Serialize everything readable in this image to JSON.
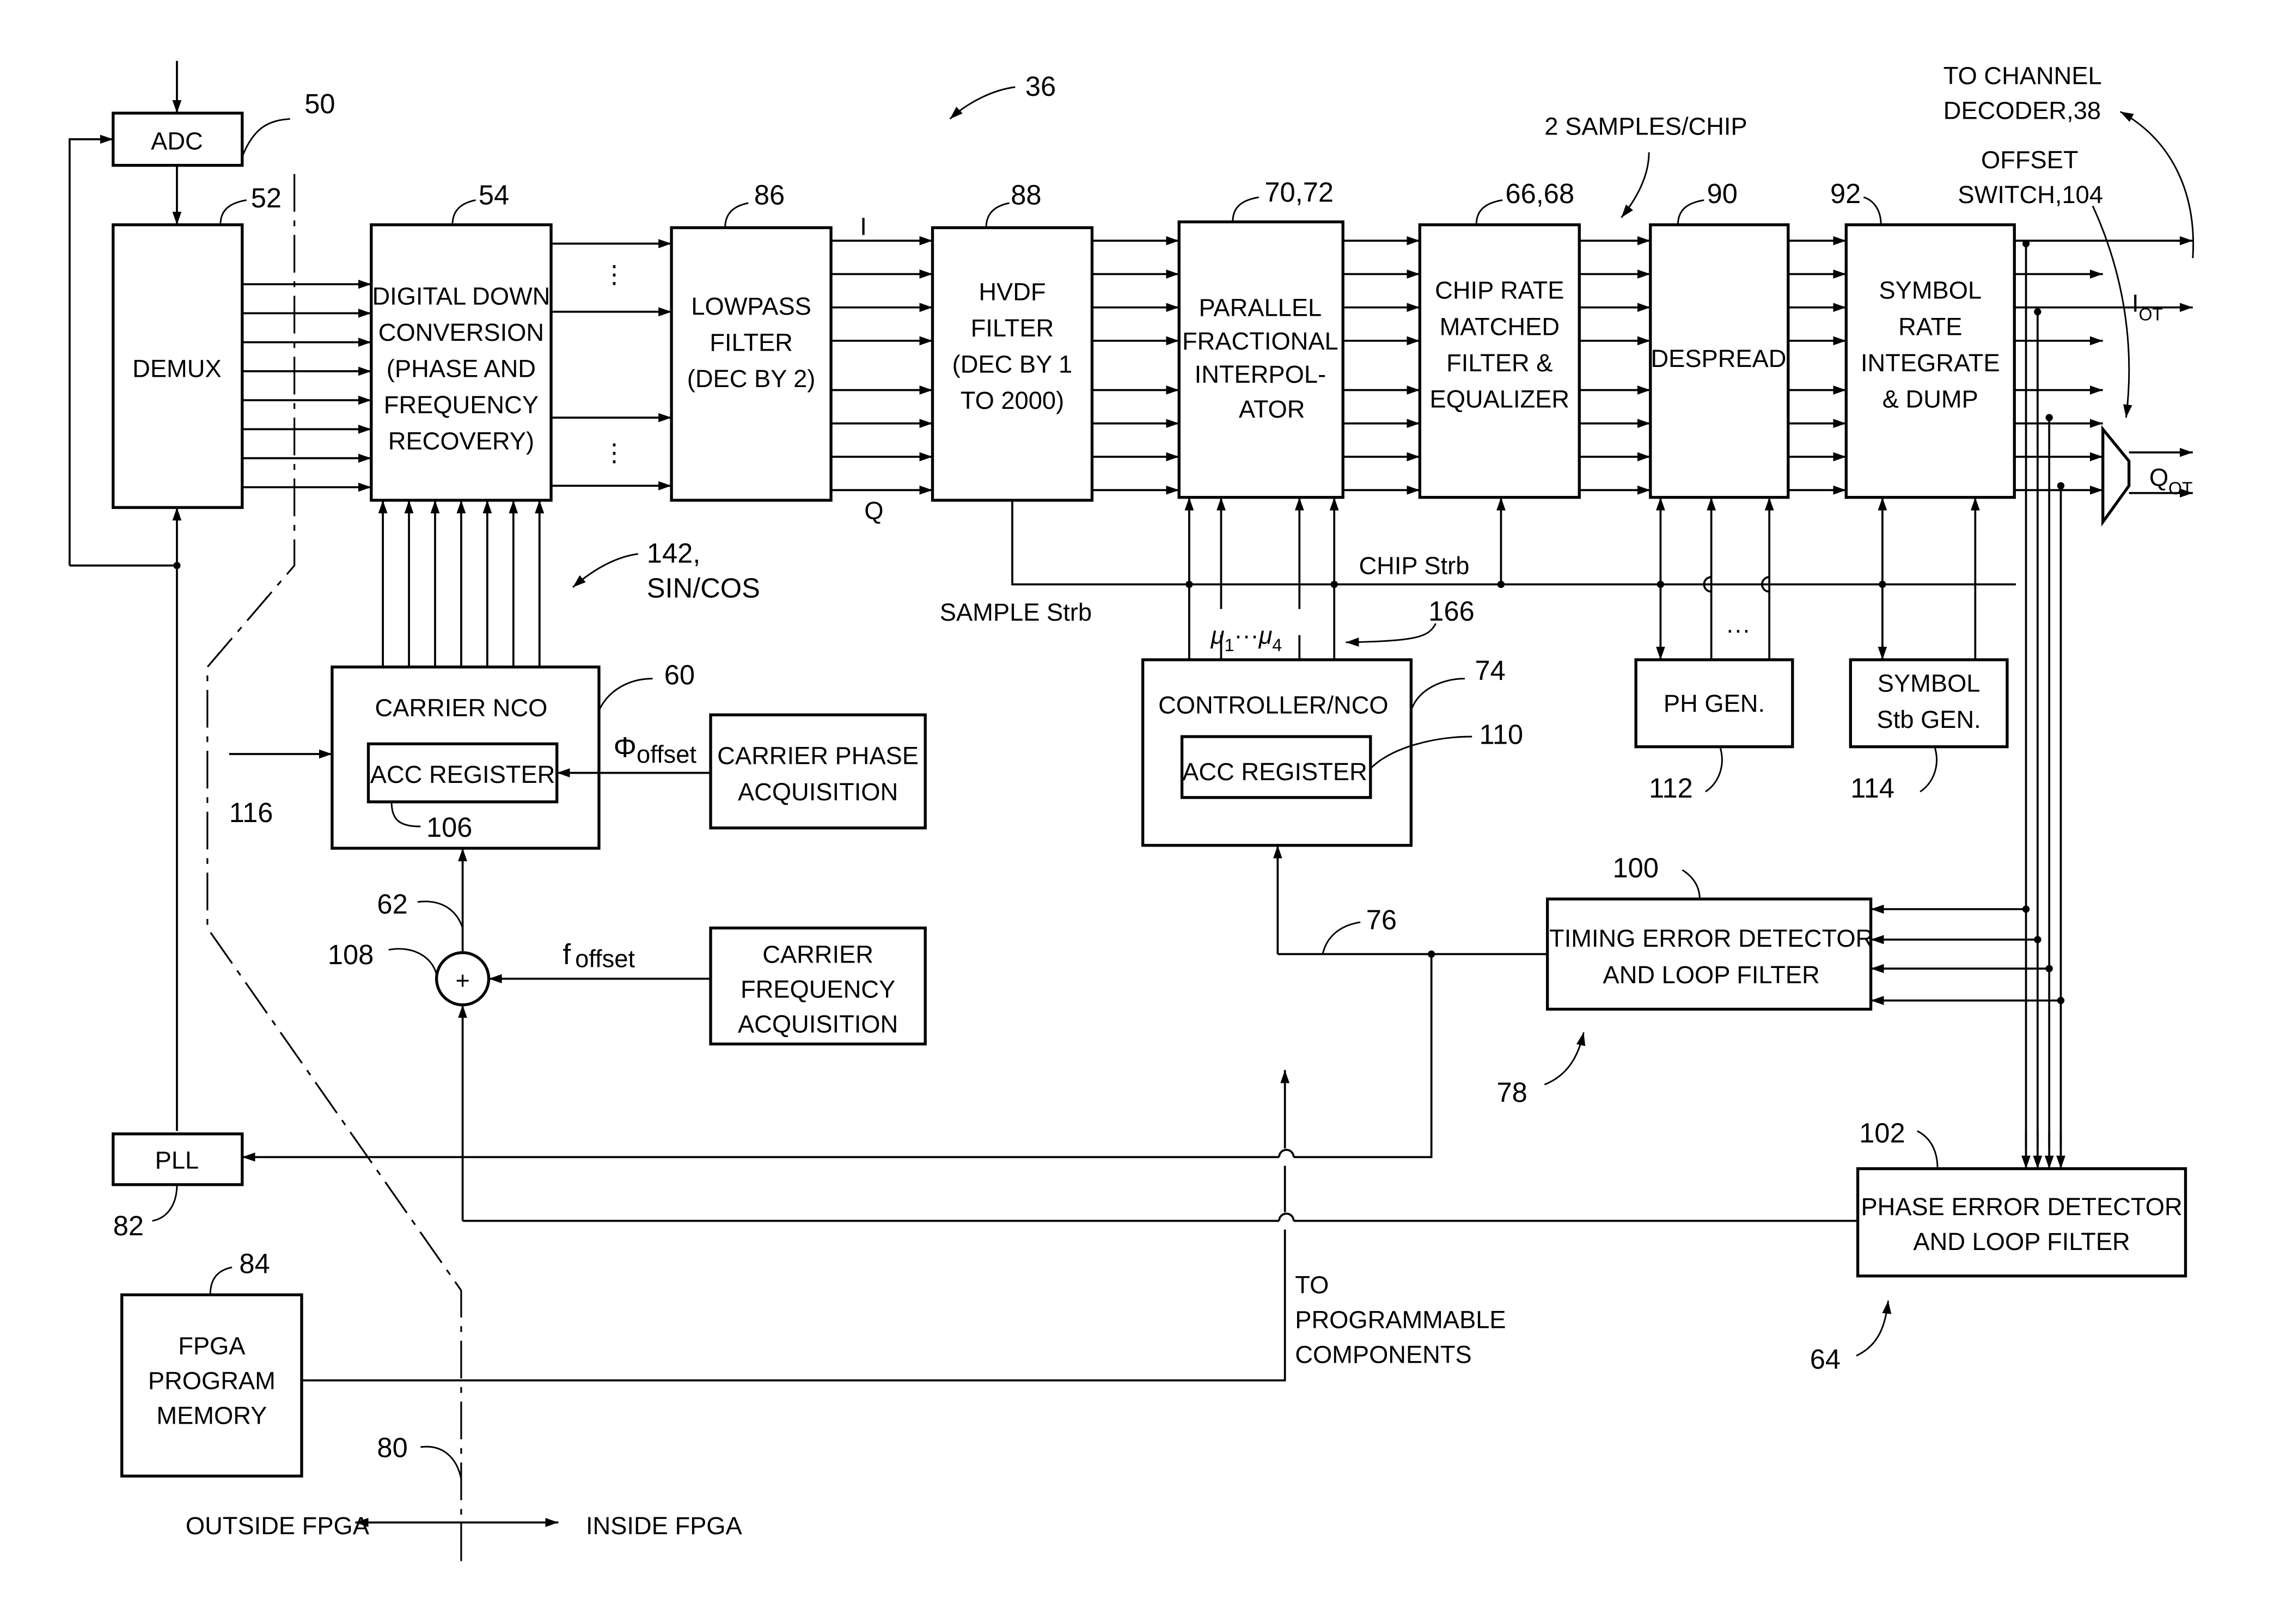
{
  "figure": {
    "reference": "36",
    "blocks": {
      "adc": {
        "label": [
          "ADC"
        ],
        "ref": "50"
      },
      "demux": {
        "label": [
          "DEMUX"
        ],
        "ref": "52"
      },
      "ddc": {
        "label": [
          "DIGITAL DOWN",
          "CONVERSION",
          "(PHASE AND",
          "FREQUENCY",
          "RECOVERY)"
        ],
        "ref": "54"
      },
      "lowpass": {
        "label": [
          "LOWPASS",
          "FILTER",
          "(DEC BY 2)"
        ],
        "ref": "86"
      },
      "hvdf": {
        "label": [
          "HVDF",
          "FILTER",
          "(DEC BY 1",
          "TO 2000)"
        ],
        "ref": "88"
      },
      "interpolator": {
        "label": [
          "PARALLEL",
          "FRACTIONAL",
          "INTERPOL-",
          "ATOR"
        ],
        "ref": "70,72"
      },
      "matched_filter": {
        "label": [
          "CHIP RATE",
          "MATCHED",
          "FILTER &",
          "EQUALIZER"
        ],
        "ref": "66,68"
      },
      "despread": {
        "label": [
          "DESPREAD"
        ],
        "ref": "90"
      },
      "integrate_dump": {
        "label": [
          "SYMBOL",
          "RATE",
          "INTEGRATE",
          "& DUMP"
        ],
        "ref": "92"
      },
      "carrier_nco": {
        "label": [
          "CARRIER NCO"
        ],
        "ref": "60",
        "register": {
          "label": "ACC REGISTER",
          "ref": "106"
        }
      },
      "carrier_phase_acq": {
        "label": [
          "CARRIER PHASE",
          "ACQUISITION"
        ]
      },
      "carrier_freq_acq": {
        "label": [
          "CARRIER",
          "FREQUENCY",
          "ACQUISITION"
        ]
      },
      "controller_nco": {
        "label": [
          "CONTROLLER/NCO"
        ],
        "ref": "74",
        "register": {
          "label": "ACC REGISTER",
          "ref": "110"
        }
      },
      "ph_gen": {
        "label": [
          "PH GEN."
        ],
        "ref": "112"
      },
      "symbol_stb_gen": {
        "label": [
          "SYMBOL",
          "Stb GEN."
        ],
        "ref": "114"
      },
      "timing_error": {
        "label": [
          "TIMING ERROR DETECTOR",
          "AND LOOP FILTER"
        ],
        "ref": "100"
      },
      "phase_error": {
        "label": [
          "PHASE ERROR DETECTOR",
          "AND LOOP FILTER"
        ],
        "ref": "102"
      },
      "pll": {
        "label": [
          "PLL"
        ],
        "ref": "82"
      },
      "fpga_memory": {
        "label": [
          "FPGA",
          "PROGRAM",
          "MEMORY"
        ],
        "ref": "84"
      },
      "summer": {
        "symbol": "+",
        "ref": "108"
      }
    },
    "signals": {
      "i": "I",
      "q": "Q",
      "sin_cos": [
        "142,",
        "SIN/COS"
      ],
      "phi_offset": {
        "main": "Φ",
        "sub": "offset"
      },
      "f_offset": {
        "main": "f",
        "sub": "offset"
      },
      "sample_strb": "SAMPLE Strb",
      "chip_strb": "CHIP Strb",
      "mu": {
        "first": "μ",
        "first_sub": "1",
        "dots": "···",
        "last": "μ",
        "last_sub": "4"
      },
      "mu_ref": "166",
      "samples_per_chip": "2 SAMPLES/CHIP",
      "to_channel_decoder": [
        "TO CHANNEL",
        "DECODER,38"
      ],
      "offset_switch": [
        "OFFSET",
        "SWITCH,104"
      ],
      "i_ot": {
        "main": "I",
        "sub": "OT"
      },
      "q_ot": {
        "main": "Q",
        "sub": "OT"
      },
      "to_programmable": [
        "TO",
        "PROGRAMMABLE",
        "COMPONENTS"
      ],
      "ref_116": "116",
      "ref_62": "62",
      "ref_76": "76",
      "ref_78": "78",
      "ref_64": "64",
      "ref_80": "80",
      "ellipsis": "···"
    },
    "boundary": {
      "outside": "OUTSIDE FPGA",
      "inside": "INSIDE FPGA"
    }
  }
}
